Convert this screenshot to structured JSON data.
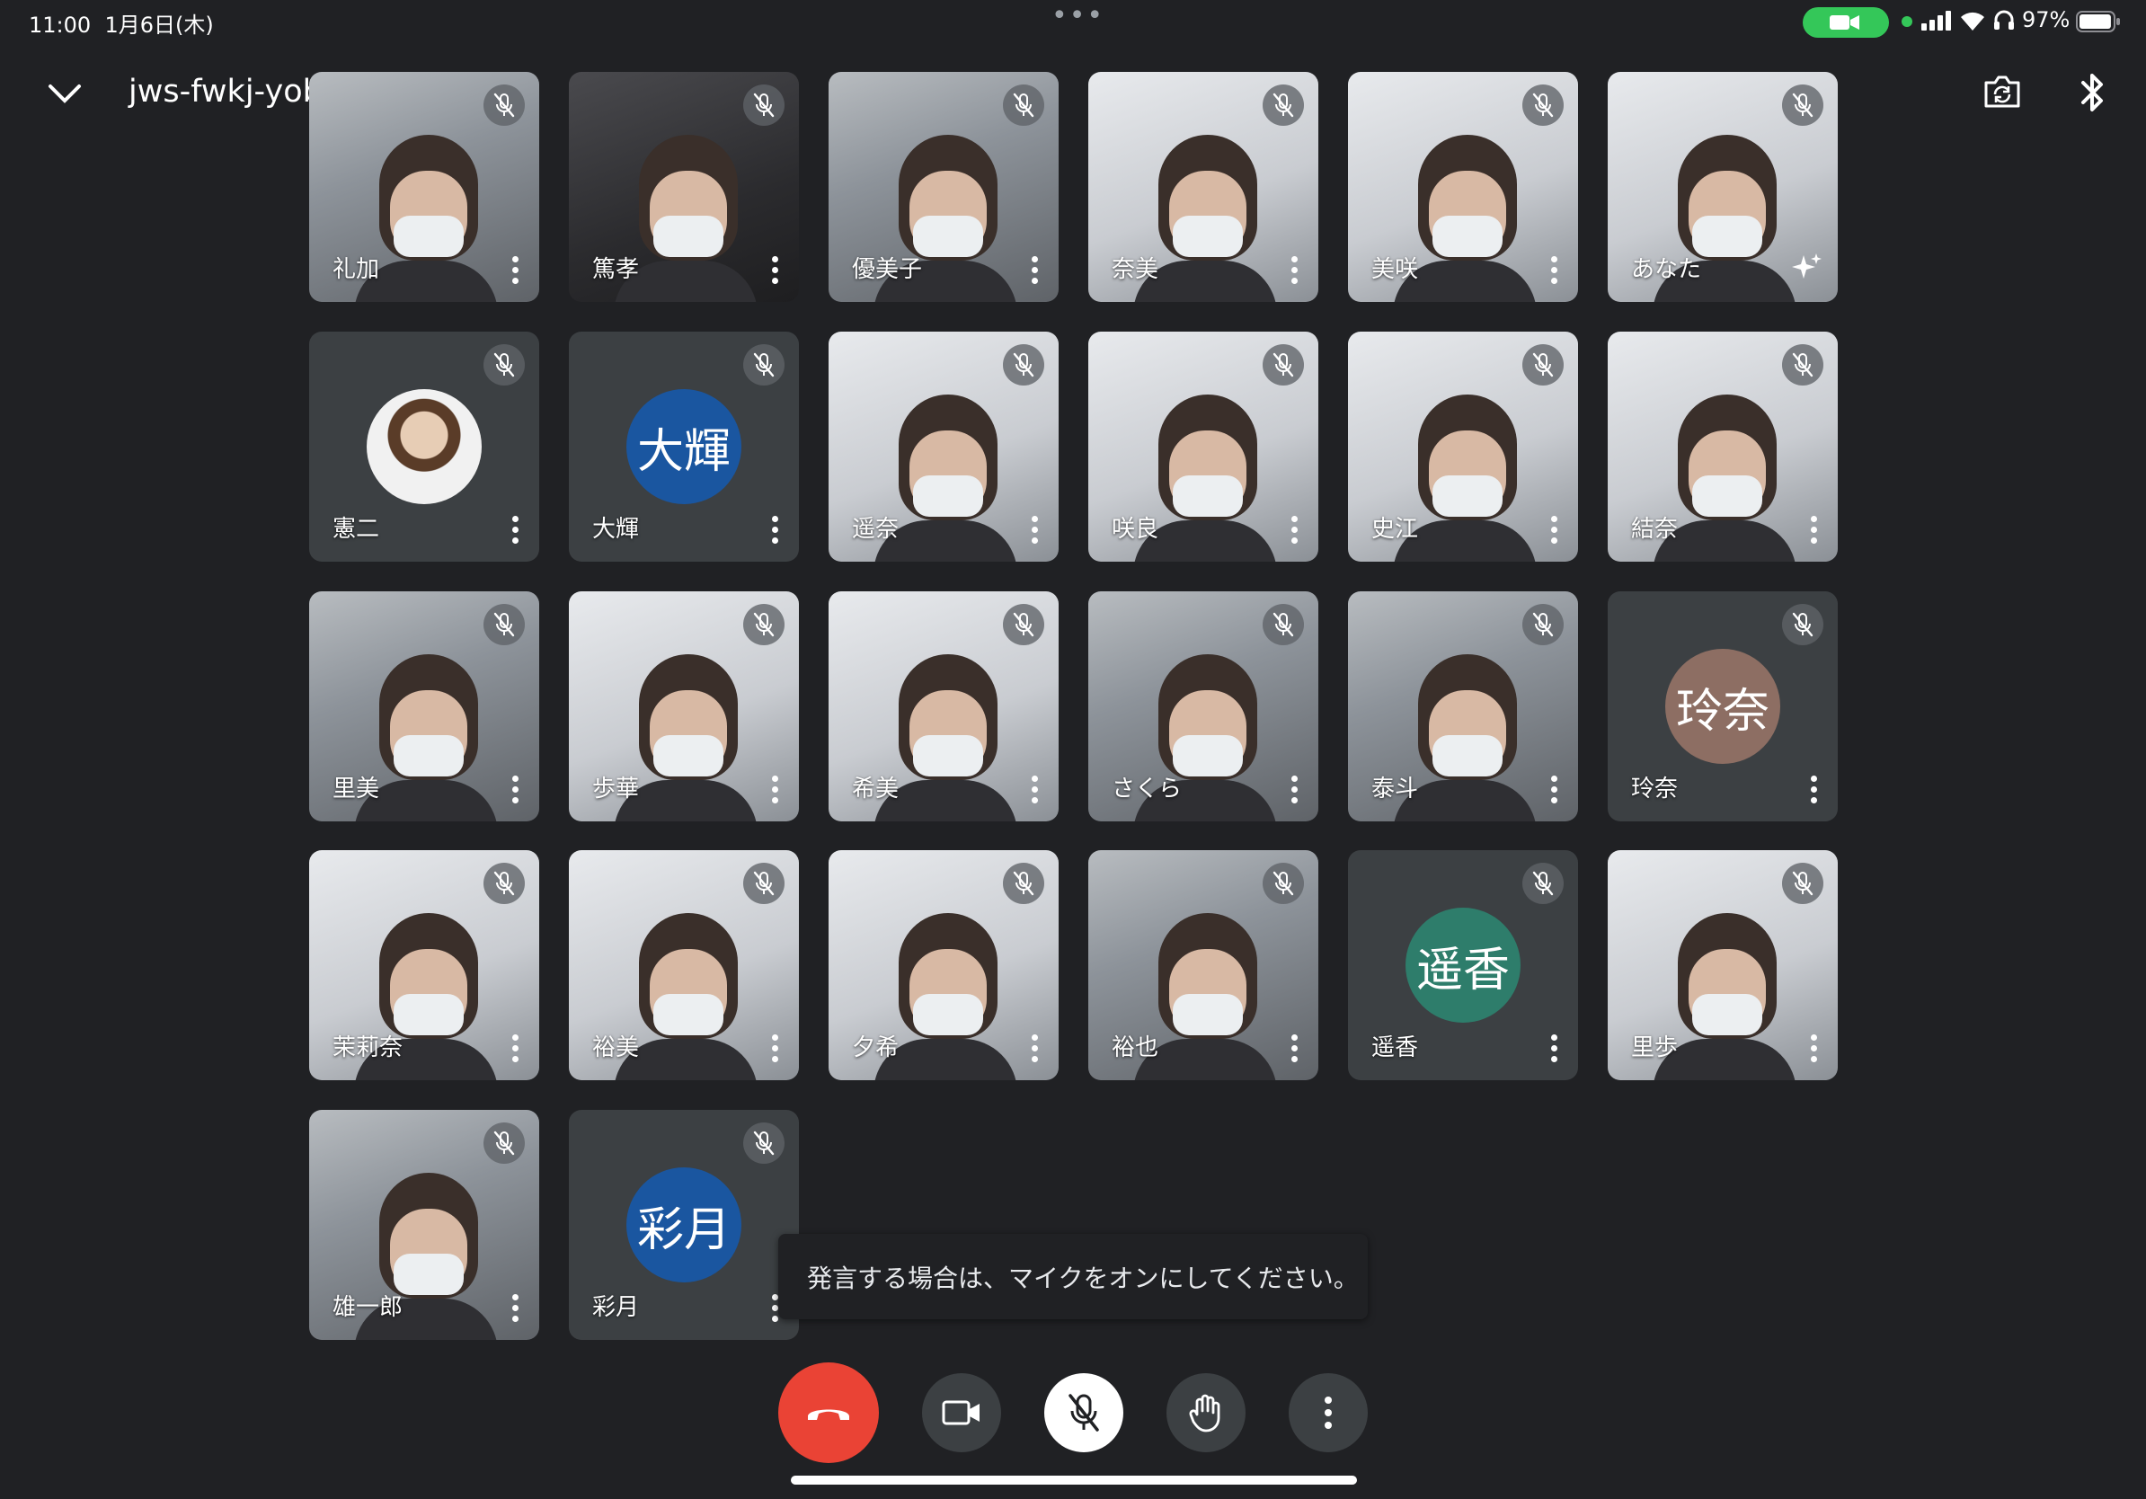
{
  "status_bar": {
    "time": "11:00",
    "date": "1月6日(木)",
    "battery_percent": "97%",
    "battery_level": 0.97,
    "camera_in_use_color": "#34c759"
  },
  "header": {
    "meeting_code": "jws-fwkj-yob",
    "icons": [
      "chevron-down-icon",
      "caret-right-icon",
      "switch-camera-icon",
      "bluetooth-icon"
    ]
  },
  "participants": [
    {
      "name": "礼加",
      "type": "video",
      "muted": true
    },
    {
      "name": "篤孝",
      "type": "video",
      "muted": true
    },
    {
      "name": "優美子",
      "type": "video",
      "muted": true
    },
    {
      "name": "奈美",
      "type": "video",
      "muted": true
    },
    {
      "name": "美咲",
      "type": "video",
      "muted": true
    },
    {
      "name": "あなた",
      "type": "video",
      "muted": true
    },
    {
      "name": "憲二",
      "type": "photo",
      "muted": true
    },
    {
      "name": "大輝",
      "type": "initials",
      "avatar_text": "大輝",
      "avatar_color": "#1a56a0",
      "muted": true
    },
    {
      "name": "遥奈",
      "type": "video",
      "muted": true
    },
    {
      "name": "咲良",
      "type": "video",
      "muted": true
    },
    {
      "name": "史江",
      "type": "video",
      "muted": true
    },
    {
      "name": "結奈",
      "type": "video",
      "muted": true
    },
    {
      "name": "里美",
      "type": "video",
      "muted": true
    },
    {
      "name": "歩華",
      "type": "video",
      "muted": true
    },
    {
      "name": "希美",
      "type": "video",
      "muted": true
    },
    {
      "name": "さくら",
      "type": "video",
      "muted": true
    },
    {
      "name": "泰斗",
      "type": "video",
      "muted": true
    },
    {
      "name": "玲奈",
      "type": "initials",
      "avatar_text": "玲奈",
      "avatar_color": "#8d6e63",
      "muted": true
    },
    {
      "name": "茉莉奈",
      "type": "video",
      "muted": true
    },
    {
      "name": "裕美",
      "type": "video",
      "muted": true
    },
    {
      "name": "夕希",
      "type": "video",
      "muted": true
    },
    {
      "name": "裕也",
      "type": "video",
      "muted": true
    },
    {
      "name": "遥香",
      "type": "initials",
      "avatar_text": "遥香",
      "avatar_color": "#2e7d6b",
      "muted": true
    },
    {
      "name": "里歩",
      "type": "video",
      "muted": true
    },
    {
      "name": "雄一郎",
      "type": "video",
      "muted": true
    },
    {
      "name": "彩月",
      "type": "initials",
      "avatar_text": "彩月",
      "avatar_color": "#1a56a0",
      "muted": true
    }
  ],
  "toast": {
    "message": "発言する場合は、マイクをオンにしてください。"
  },
  "controls": {
    "end_call_color": "#ea4335",
    "icons": [
      "end-call-icon",
      "camera-icon",
      "mic-off-icon",
      "raise-hand-icon",
      "more-options-icon"
    ]
  }
}
